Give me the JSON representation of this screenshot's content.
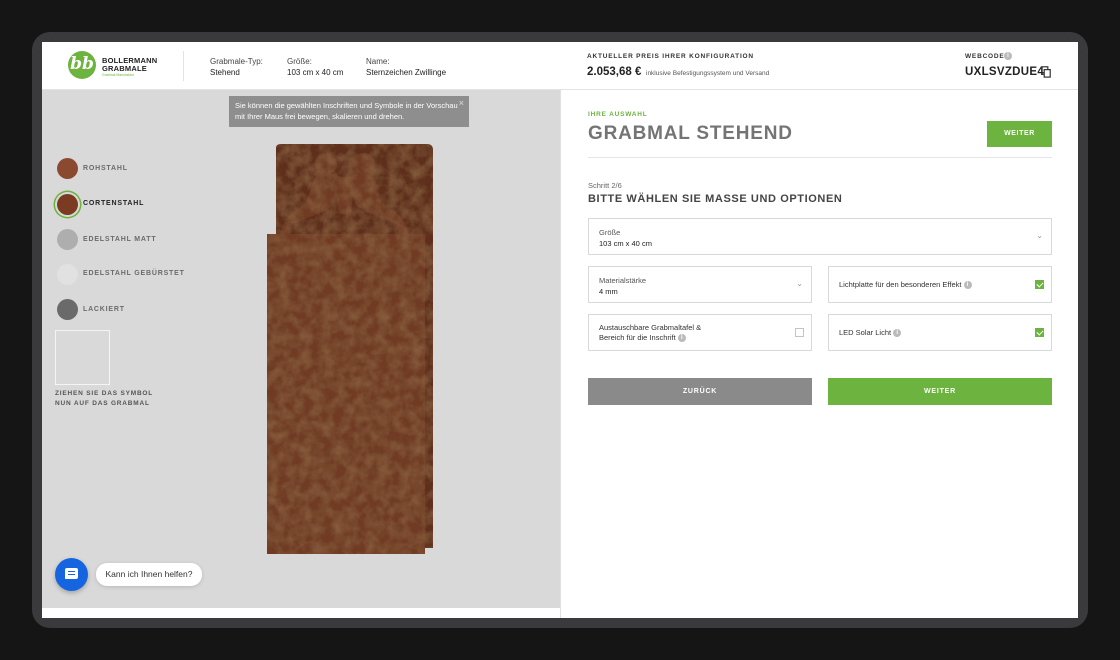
{
  "brand": {
    "logo_letters": "bb",
    "line1": "BOLLERMANN",
    "line2": "GRABMALE",
    "tagline": "Grabmal Manufaktur"
  },
  "header": {
    "type_label": "Grabmale-Typ:",
    "type_value": "Stehend",
    "size_label": "Größe:",
    "size_value": "103 cm x 40 cm",
    "name_label": "Name:",
    "name_value": "Sternzeichen Zwillinge",
    "price_label": "AKTUELLER PREIS IHRER KONFIGURATION",
    "price_value": "2.053,68 €",
    "price_note": "inklusive Befestigungssystem und Versand",
    "webcode_label": "WEBCODE",
    "webcode_value": "UXLSVZDUE4"
  },
  "preview": {
    "tooltip": "Sie können die gewählten Inschriften und Symbole in der Vorschau mit Ihrer Maus frei bewegen, skalieren und drehen.",
    "tooltip_close": "×",
    "materials": [
      {
        "label": "ROHSTAHL",
        "color": "#8b4a30",
        "selected": false
      },
      {
        "label": "CORTENSTAHL",
        "color": "#7a3b22",
        "selected": true
      },
      {
        "label": "EDELSTAHL MATT",
        "color": "#aeaeae",
        "selected": false
      },
      {
        "label": "EDELSTAHL GEBÜRSTET",
        "color": "#e1e1e1",
        "selected": false
      },
      {
        "label": "LACKIERT",
        "color": "#6a6a6a",
        "selected": false
      }
    ],
    "symbol_hint_1": "ZIEHEN SIE DAS SYMBOL",
    "symbol_hint_2": "NUN AUF DAS GRABMAL"
  },
  "chat": {
    "bubble": "Kann ich Ihnen helfen?"
  },
  "config": {
    "section_label": "IHRE AUSWAHL",
    "title": "GRABMAL STEHEND",
    "top_button": "WEITER",
    "step": "Schritt 2/6",
    "step_title": "BITTE WÄHLEN SIE MASSE UND OPTIONEN",
    "size_field": {
      "label": "Größe",
      "value": "103 cm x 40 cm"
    },
    "thickness_field": {
      "label": "Materialstärke",
      "value": "4 mm"
    },
    "light_plate": {
      "label": "Lichtplatte für den besonderen Effekt",
      "checked": true
    },
    "exchangeable": {
      "label_1": "Austauschbare Grabmaltafel &",
      "label_2": "Bereich für die Inschrift",
      "checked": false
    },
    "led": {
      "label": "LED Solar Licht",
      "checked": true
    },
    "back_button": "ZURÜCK",
    "next_button": "WEITER"
  },
  "colors": {
    "accent": "#6cb33f",
    "back": "#8a8a8a",
    "corten": "#6d3822"
  },
  "icons": {
    "chevron": "⌄",
    "info": "i"
  }
}
